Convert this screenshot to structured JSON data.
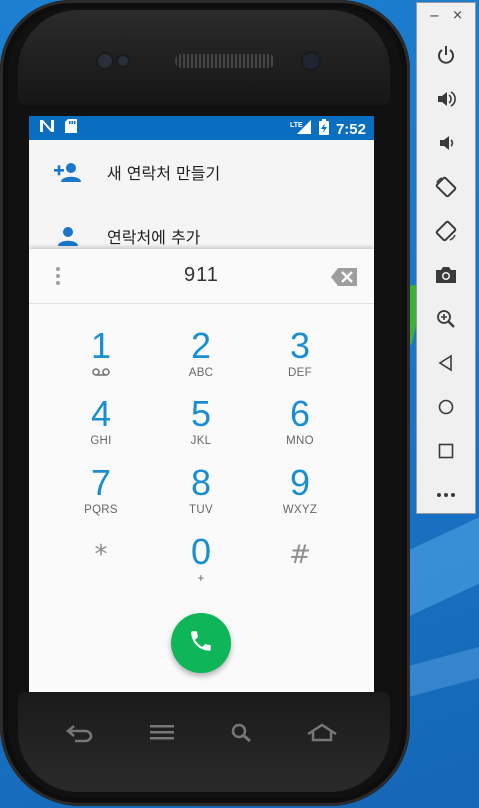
{
  "statusbar": {
    "time": "7:52",
    "network": "LTE"
  },
  "suggestions": [
    {
      "label": "새 연락처 만들기",
      "icon": "add-person-icon"
    },
    {
      "label": "연락처에 추가",
      "icon": "person-icon"
    }
  ],
  "dialer": {
    "digits": "911",
    "keys": [
      {
        "num": "1",
        "letters": ""
      },
      {
        "num": "2",
        "letters": "ABC"
      },
      {
        "num": "3",
        "letters": "DEF"
      },
      {
        "num": "4",
        "letters": "GHI"
      },
      {
        "num": "5",
        "letters": "JKL"
      },
      {
        "num": "6",
        "letters": "MNO"
      },
      {
        "num": "7",
        "letters": "PQRS"
      },
      {
        "num": "8",
        "letters": "TUV"
      },
      {
        "num": "9",
        "letters": "WXYZ"
      },
      {
        "num": "*",
        "letters": ""
      },
      {
        "num": "0",
        "letters": "+"
      },
      {
        "num": "#",
        "letters": ""
      }
    ]
  },
  "emulator": {
    "minimize": "−",
    "close": "×",
    "buttons": [
      "power-icon",
      "volume-up-icon",
      "volume-down-icon",
      "rotate-left-icon",
      "rotate-right-icon",
      "camera-icon",
      "zoom-icon",
      "back-icon",
      "home-icon",
      "overview-icon",
      "more-icon"
    ]
  },
  "colors": {
    "accent": "#1a8ed3",
    "statusbar": "#0a6ec0",
    "call": "#0fb559"
  }
}
